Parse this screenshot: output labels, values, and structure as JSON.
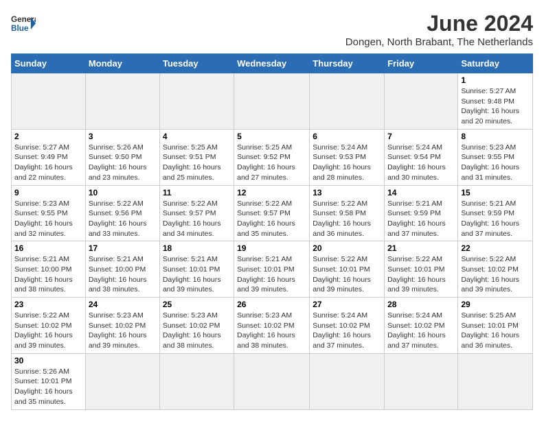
{
  "header": {
    "logo_general": "General",
    "logo_blue": "Blue",
    "month_year": "June 2024",
    "location": "Dongen, North Brabant, The Netherlands"
  },
  "weekdays": [
    "Sunday",
    "Monday",
    "Tuesday",
    "Wednesday",
    "Thursday",
    "Friday",
    "Saturday"
  ],
  "weeks": [
    [
      {
        "day": "",
        "empty": true
      },
      {
        "day": "",
        "empty": true
      },
      {
        "day": "",
        "empty": true
      },
      {
        "day": "",
        "empty": true
      },
      {
        "day": "",
        "empty": true
      },
      {
        "day": "",
        "empty": true
      },
      {
        "day": "1",
        "sunrise": "5:27 AM",
        "sunset": "9:48 PM",
        "daylight": "16 hours and 20 minutes."
      }
    ],
    [
      {
        "day": "2",
        "sunrise": "5:27 AM",
        "sunset": "9:49 PM",
        "daylight": "16 hours and 22 minutes."
      },
      {
        "day": "3",
        "sunrise": "5:26 AM",
        "sunset": "9:50 PM",
        "daylight": "16 hours and 23 minutes."
      },
      {
        "day": "4",
        "sunrise": "5:25 AM",
        "sunset": "9:51 PM",
        "daylight": "16 hours and 25 minutes."
      },
      {
        "day": "5",
        "sunrise": "5:25 AM",
        "sunset": "9:52 PM",
        "daylight": "16 hours and 27 minutes."
      },
      {
        "day": "6",
        "sunrise": "5:24 AM",
        "sunset": "9:53 PM",
        "daylight": "16 hours and 28 minutes."
      },
      {
        "day": "7",
        "sunrise": "5:24 AM",
        "sunset": "9:54 PM",
        "daylight": "16 hours and 30 minutes."
      },
      {
        "day": "8",
        "sunrise": "5:23 AM",
        "sunset": "9:55 PM",
        "daylight": "16 hours and 31 minutes."
      }
    ],
    [
      {
        "day": "9",
        "sunrise": "5:23 AM",
        "sunset": "9:55 PM",
        "daylight": "16 hours and 32 minutes."
      },
      {
        "day": "10",
        "sunrise": "5:22 AM",
        "sunset": "9:56 PM",
        "daylight": "16 hours and 33 minutes."
      },
      {
        "day": "11",
        "sunrise": "5:22 AM",
        "sunset": "9:57 PM",
        "daylight": "16 hours and 34 minutes."
      },
      {
        "day": "12",
        "sunrise": "5:22 AM",
        "sunset": "9:57 PM",
        "daylight": "16 hours and 35 minutes."
      },
      {
        "day": "13",
        "sunrise": "5:22 AM",
        "sunset": "9:58 PM",
        "daylight": "16 hours and 36 minutes."
      },
      {
        "day": "14",
        "sunrise": "5:21 AM",
        "sunset": "9:59 PM",
        "daylight": "16 hours and 37 minutes."
      },
      {
        "day": "15",
        "sunrise": "5:21 AM",
        "sunset": "9:59 PM",
        "daylight": "16 hours and 37 minutes."
      }
    ],
    [
      {
        "day": "16",
        "sunrise": "5:21 AM",
        "sunset": "10:00 PM",
        "daylight": "16 hours and 38 minutes."
      },
      {
        "day": "17",
        "sunrise": "5:21 AM",
        "sunset": "10:00 PM",
        "daylight": "16 hours and 38 minutes."
      },
      {
        "day": "18",
        "sunrise": "5:21 AM",
        "sunset": "10:01 PM",
        "daylight": "16 hours and 39 minutes."
      },
      {
        "day": "19",
        "sunrise": "5:21 AM",
        "sunset": "10:01 PM",
        "daylight": "16 hours and 39 minutes."
      },
      {
        "day": "20",
        "sunrise": "5:22 AM",
        "sunset": "10:01 PM",
        "daylight": "16 hours and 39 minutes."
      },
      {
        "day": "21",
        "sunrise": "5:22 AM",
        "sunset": "10:01 PM",
        "daylight": "16 hours and 39 minutes."
      },
      {
        "day": "22",
        "sunrise": "5:22 AM",
        "sunset": "10:02 PM",
        "daylight": "16 hours and 39 minutes."
      }
    ],
    [
      {
        "day": "23",
        "sunrise": "5:22 AM",
        "sunset": "10:02 PM",
        "daylight": "16 hours and 39 minutes."
      },
      {
        "day": "24",
        "sunrise": "5:23 AM",
        "sunset": "10:02 PM",
        "daylight": "16 hours and 39 minutes."
      },
      {
        "day": "25",
        "sunrise": "5:23 AM",
        "sunset": "10:02 PM",
        "daylight": "16 hours and 38 minutes."
      },
      {
        "day": "26",
        "sunrise": "5:23 AM",
        "sunset": "10:02 PM",
        "daylight": "16 hours and 38 minutes."
      },
      {
        "day": "27",
        "sunrise": "5:24 AM",
        "sunset": "10:02 PM",
        "daylight": "16 hours and 37 minutes."
      },
      {
        "day": "28",
        "sunrise": "5:24 AM",
        "sunset": "10:02 PM",
        "daylight": "16 hours and 37 minutes."
      },
      {
        "day": "29",
        "sunrise": "5:25 AM",
        "sunset": "10:01 PM",
        "daylight": "16 hours and 36 minutes."
      }
    ],
    [
      {
        "day": "30",
        "sunrise": "5:26 AM",
        "sunset": "10:01 PM",
        "daylight": "16 hours and 35 minutes."
      },
      {
        "day": "",
        "empty": true
      },
      {
        "day": "",
        "empty": true
      },
      {
        "day": "",
        "empty": true
      },
      {
        "day": "",
        "empty": true
      },
      {
        "day": "",
        "empty": true
      },
      {
        "day": "",
        "empty": true
      }
    ]
  ]
}
